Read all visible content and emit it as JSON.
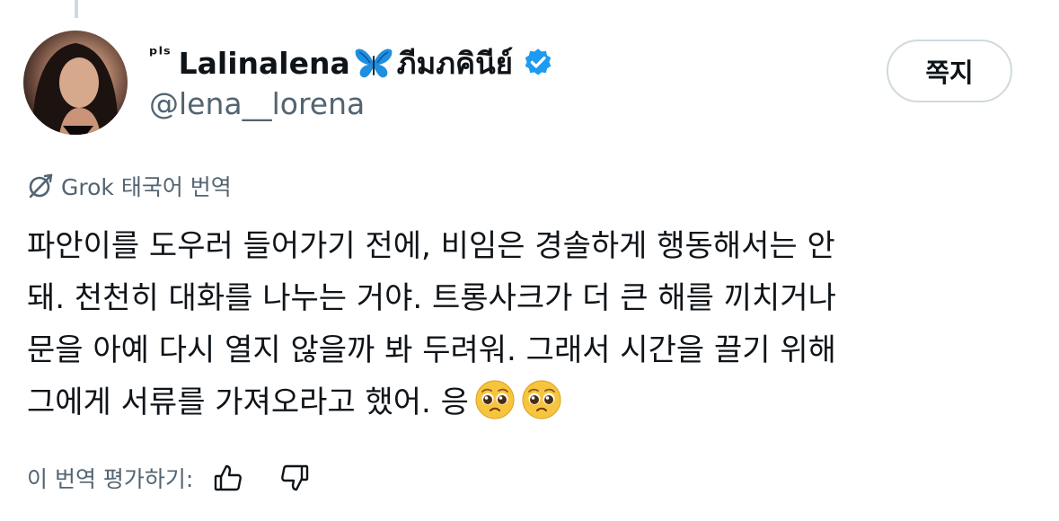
{
  "post": {
    "author": {
      "name_prefix": "ᵖˡˢ",
      "name": "Lalinalena",
      "name_thai": "ภีมภคินีย์",
      "handle": "@lena__lorena",
      "verified": true
    },
    "message_button_label": "쪽지",
    "translation_label": "Grok 태국어 번역",
    "translation_text": "파안이를 도우러 들어가기 전에, 비임은 경솔하게 행동해서는 안\n돼. 천천히 대화를 나누는 거야. 트롱사크가 더 큰 해를 끼치거나\n문을 아예 다시 열지 않을까 봐 두려워. 그래서 시간을 끌기 위해\n그에게 서류를 가져오라고 했어. 응",
    "rate_label": "이 번역 평가하기:"
  },
  "icons": {
    "verified": "verified-badge-icon",
    "butterfly": "blue-butterfly-emoji",
    "grok": "grok-icon",
    "emoji": "pleading-face-emoji",
    "like": "thumbs-up-icon",
    "dislike": "thumbs-down-icon"
  },
  "colors": {
    "text_primary": "#0f1419",
    "text_secondary": "#536471",
    "verified_blue": "#1d9bf0",
    "border": "#cfd9de"
  }
}
